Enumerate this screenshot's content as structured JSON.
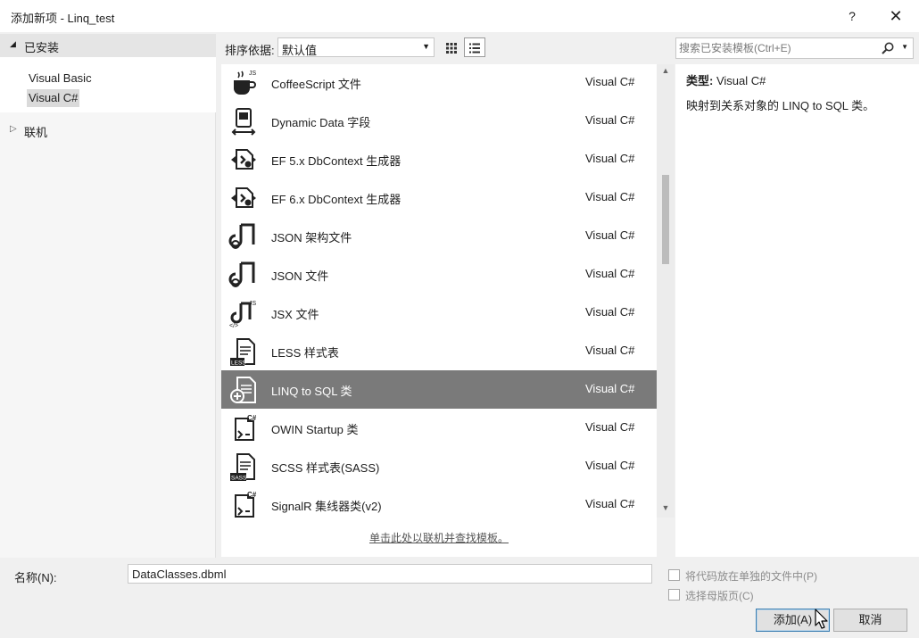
{
  "window": {
    "title": "添加新项 - Linq_test",
    "help_label": "?",
    "close_label": "✕"
  },
  "left_tree": {
    "installed_arrow": "◢",
    "installed_label": "已安装",
    "items": [
      {
        "label": "Visual Basic"
      },
      {
        "label": "Visual C#"
      }
    ],
    "online_arrow": "▷",
    "online_label": "联机"
  },
  "toolbar": {
    "sort_label": "排序依据:",
    "sort_value": "默认值",
    "search_placeholder": "搜索已安装模板(Ctrl+E)"
  },
  "templates": [
    {
      "name": "CoffeeScript 文件",
      "lang": "Visual C#",
      "icon": "coffee-icon"
    },
    {
      "name": "Dynamic Data 字段",
      "lang": "Visual C#",
      "icon": "dynamic-data-icon"
    },
    {
      "name": "EF 5.x DbContext 生成器",
      "lang": "Visual C#",
      "icon": "ef-generator-icon"
    },
    {
      "name": "EF 6.x DbContext 生成器",
      "lang": "Visual C#",
      "icon": "ef-generator-icon"
    },
    {
      "name": "JSON 架构文件",
      "lang": "Visual C#",
      "icon": "json-icon"
    },
    {
      "name": "JSON 文件",
      "lang": "Visual C#",
      "icon": "json-icon"
    },
    {
      "name": "JSX 文件",
      "lang": "Visual C#",
      "icon": "jsx-icon"
    },
    {
      "name": "LESS 样式表",
      "lang": "Visual C#",
      "icon": "less-icon"
    },
    {
      "name": "LINQ to SQL 类",
      "lang": "Visual C#",
      "icon": "linq-sql-icon"
    },
    {
      "name": "OWIN Startup 类",
      "lang": "Visual C#",
      "icon": "csharp-class-icon"
    },
    {
      "name": "SCSS 样式表(SASS)",
      "lang": "Visual C#",
      "icon": "scss-icon"
    },
    {
      "name": "SignalR 集线器类(v2)",
      "lang": "Visual C#",
      "icon": "csharp-class-icon"
    }
  ],
  "selected_index": 8,
  "online_link": "单击此处以联机并查找模板。",
  "detail": {
    "type_label": "类型:",
    "type_value": "Visual C#",
    "description": "映射到关系对象的 LINQ to SQL 类。"
  },
  "form": {
    "name_label": "名称(N):",
    "name_value": "DataClasses.dbml",
    "separate_file_label": "将代码放在单独的文件中(P)",
    "master_page_label": "选择母版页(C)"
  },
  "buttons": {
    "add": "添加(A)",
    "cancel": "取消"
  },
  "colors": {
    "selected_row": "#7a7a7a",
    "dialog_bg": "#f0f0f0"
  }
}
